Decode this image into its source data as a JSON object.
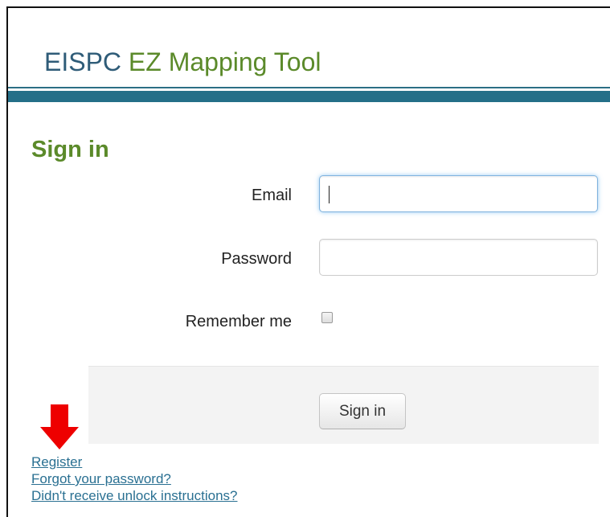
{
  "header": {
    "title_part1": "EISPC",
    "title_part2": "EZ Mapping Tool"
  },
  "page": {
    "heading": "Sign in"
  },
  "form": {
    "email_label": "Email",
    "email_value": "",
    "password_label": "Password",
    "password_value": "",
    "remember_label": "Remember me",
    "remember_checked": false,
    "submit_label": "Sign in"
  },
  "links": [
    "Register",
    "Forgot your password?",
    "Didn't receive unlock instructions?"
  ],
  "annotation": {
    "icon": "down-arrow-icon",
    "color": "#ee0000"
  },
  "colors": {
    "brand_blue": "#2f5c78",
    "brand_green": "#5b8a2a",
    "header_bar": "#246f88",
    "link": "#2a7092"
  }
}
